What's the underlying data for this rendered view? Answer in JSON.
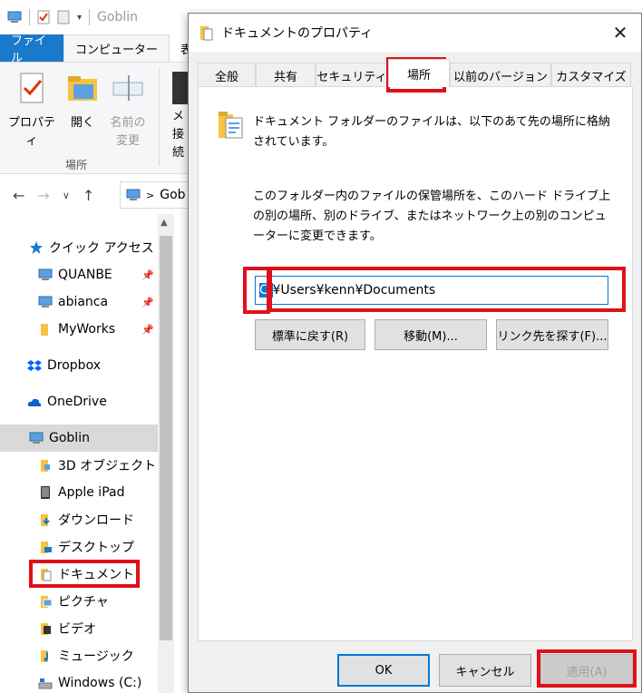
{
  "explorer": {
    "window_title": "Goblin",
    "ribbon_tabs": [
      "ファイル",
      "コンピューター",
      "表"
    ],
    "ribbon_buttons": [
      {
        "label": "プロパティ"
      },
      {
        "label": "開く"
      },
      {
        "label": "名前の\n変更"
      },
      {
        "label": "メ\n接続"
      }
    ],
    "ribbon_group_label": "場所",
    "address_label": "Gob",
    "nav_items": [
      {
        "label": "クイック アクセス",
        "icon": "star-icon"
      },
      {
        "label": "QUANBE",
        "icon": "computer-icon",
        "pinned": true
      },
      {
        "label": "abianca",
        "icon": "computer-icon",
        "pinned": true
      },
      {
        "label": "MyWorks",
        "icon": "folder-icon",
        "pinned": true
      },
      {
        "label": "Dropbox",
        "icon": "dropbox-icon"
      },
      {
        "label": "OneDrive",
        "icon": "cloud-icon"
      },
      {
        "label": "Goblin",
        "icon": "computer-icon"
      },
      {
        "label": "3D オブジェクト",
        "icon": "folder-3d-icon"
      },
      {
        "label": "Apple iPad",
        "icon": "ipad-icon"
      },
      {
        "label": "ダウンロード",
        "icon": "download-folder-icon"
      },
      {
        "label": "デスクトップ",
        "icon": "desktop-folder-icon"
      },
      {
        "label": "ドキュメント",
        "icon": "documents-folder-icon"
      },
      {
        "label": "ピクチャ",
        "icon": "pictures-folder-icon"
      },
      {
        "label": "ビデオ",
        "icon": "videos-folder-icon"
      },
      {
        "label": "ミュージック",
        "icon": "music-folder-icon"
      },
      {
        "label": "Windows (C:)",
        "icon": "drive-icon"
      }
    ]
  },
  "dialog": {
    "title": "ドキュメントのプロパティ",
    "close_symbol": "✕",
    "tabs": [
      "全般",
      "共有",
      "セキュリティ",
      "場所",
      "以前のバージョン",
      "カスタマイズ"
    ],
    "active_tab": "場所",
    "description_1": "ドキュメント フォルダーのファイルは、以下のあて先の場所に格納されています。",
    "description_2": "このフォルダー内のファイルの保管場所を、このハード ドライブ上の別の場所、別のドライブ、またはネットワーク上の別のコンピューターに変更できます。",
    "path_value_selected": "C:",
    "path_value_rest": "¥Users¥kenn¥Documents",
    "buttons": {
      "restore": "標準に戻す(R)",
      "move": "移動(M)...",
      "find_target": "リンク先を探す(F)..."
    },
    "footer": {
      "ok": "OK",
      "cancel": "キャンセル",
      "apply": "適用(A)"
    }
  },
  "colors": {
    "highlight_red": "#e0101a",
    "accent_blue": "#0078d7",
    "file_tab_blue": "#1979ca"
  }
}
